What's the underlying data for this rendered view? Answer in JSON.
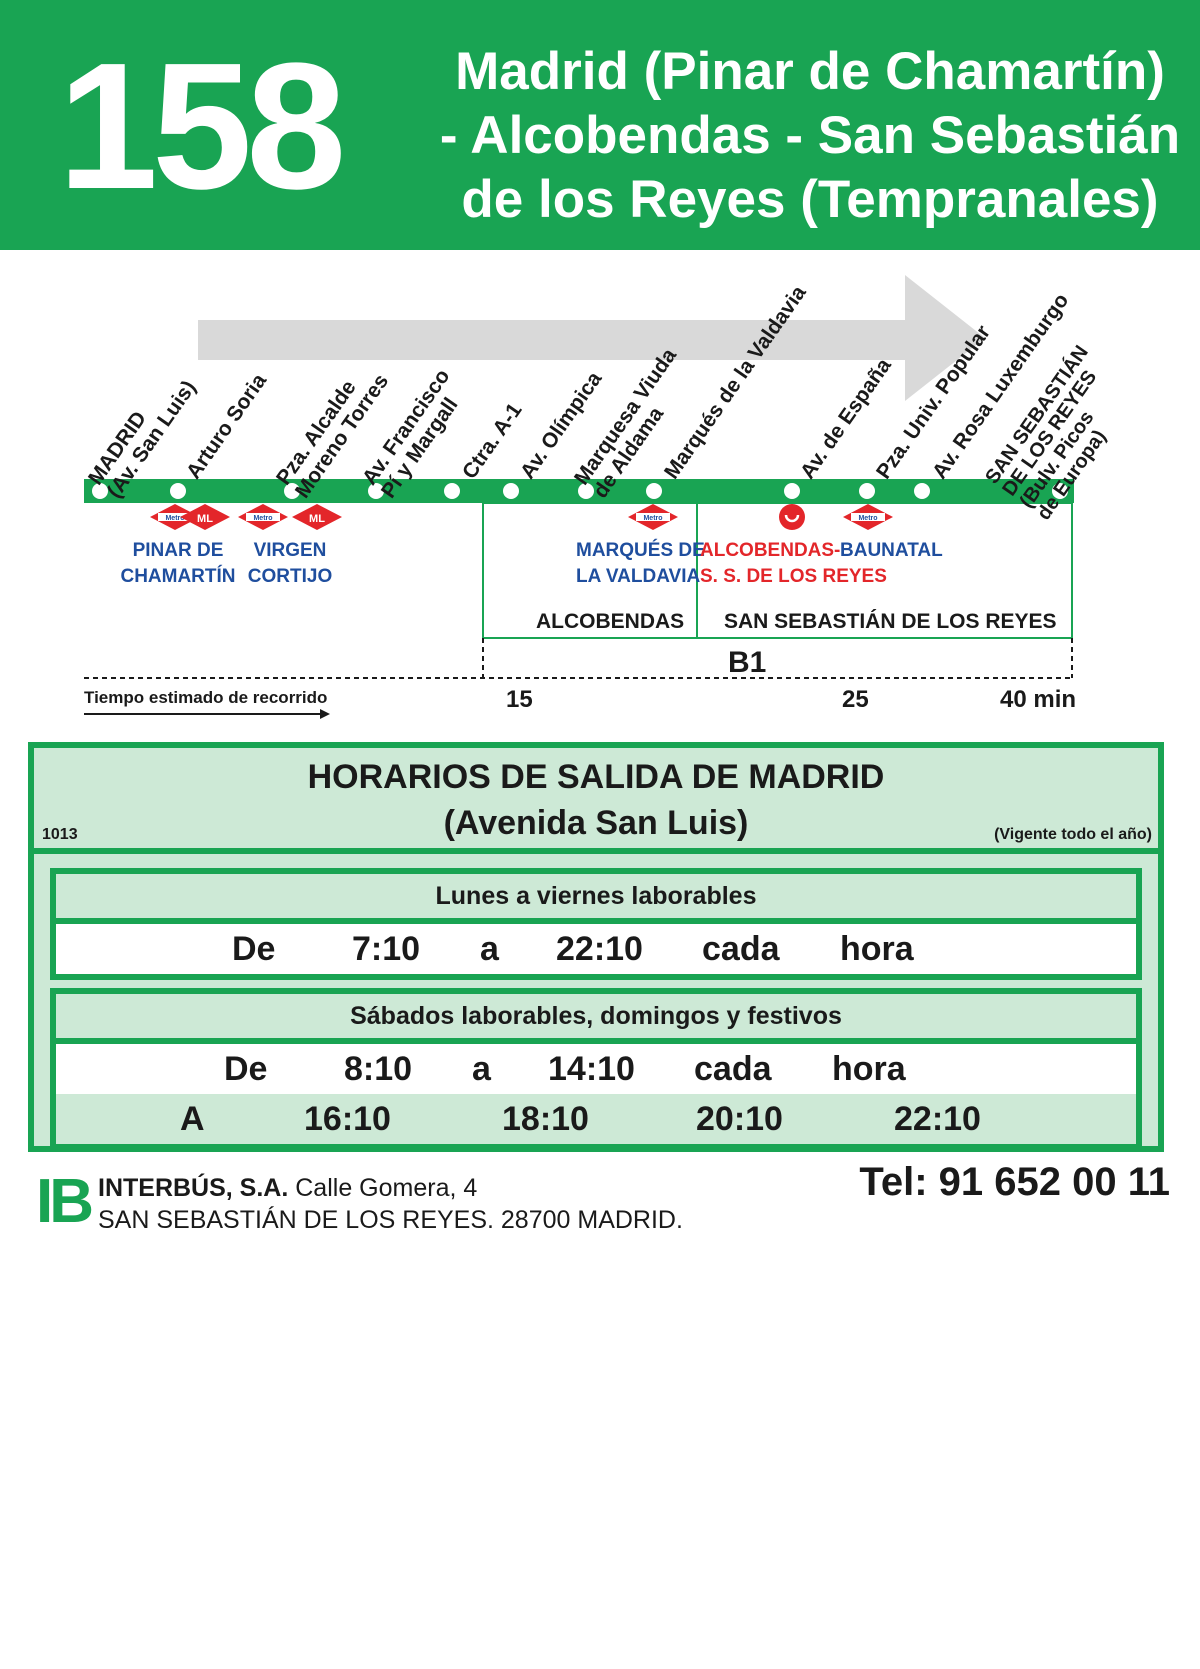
{
  "header": {
    "route_number": "158",
    "title_lines": [
      "Madrid (Pinar  de Chamartín)",
      "- Alcobendas - San Sebastián",
      "de los Reyes (Tempranales)"
    ]
  },
  "route": {
    "stops": [
      "MADRID\n(Av. San Luis)",
      "Arturo Soria",
      "Pza. Alcalde\nMoreno Torres",
      "Av. Francisco\nPí y Margall",
      "Ctra. A-1",
      "Av. Olímpica",
      "Marquesa Viuda\nde Aldama",
      "Marqués de la Valdavia",
      "Av. de España",
      "Pza. Univ. Popular",
      "Av. Rosa Luxemburgo",
      "SAN SEBASTIÁN\nDE LOS REYES\n(Bulv. Picos\nde Europa)"
    ],
    "connections": [
      {
        "text": "PINAR DE\nCHAMARTÍN",
        "color": "blue"
      },
      {
        "text": "VIRGEN\nCORTIJO",
        "color": "blue"
      },
      {
        "text": "MARQUÉS DE\nLA VALDAVIA",
        "color": "blue"
      },
      {
        "text": "ALCOBENDAS-\nS. S. DE LOS REYES",
        "color": "red"
      },
      {
        "text": "BAUNATAL",
        "color": "blue"
      }
    ],
    "badges": {
      "metro": "Metro",
      "ml": "ML"
    },
    "zones": {
      "alcobendas": "ALCOBENDAS",
      "ssreyes": "SAN SEBASTIÁN DE LOS REYES",
      "fare": "B1"
    },
    "travel_time": {
      "caption": "Tiempo estimado de recorrido",
      "marks": [
        "15",
        "25",
        "40 min"
      ]
    },
    "colors": {
      "green": "#19a453",
      "light_green": "#cde9d6",
      "metro_red": "#e3262a",
      "blue": "#1f4e9e",
      "arrow_grey": "#d9d9d9"
    }
  },
  "schedule": {
    "title_line1": "HORARIOS DE SALIDA DE MADRID",
    "title_line2": "(Avenida San Luis)",
    "code": "1013",
    "validity": "(Vigente todo el año)",
    "weekday": {
      "heading": "Lunes a viernes laborables",
      "row": [
        "De",
        "7:10",
        "a",
        "22:10",
        "cada",
        "hora"
      ]
    },
    "weekend": {
      "heading": "Sábados laborables, domingos y festivos",
      "row1": [
        "De",
        "8:10",
        "a",
        "14:10",
        "cada",
        "hora"
      ],
      "row2": [
        "A",
        "16:10",
        "18:10",
        "20:10",
        "22:10"
      ]
    }
  },
  "footer": {
    "logo": "IB",
    "company_name": "INTERBÚS, S.A.",
    "address_line1": "Calle Gomera, 4",
    "address_line2": "SAN SEBASTIÁN DE LOS REYES. 28700 MADRID.",
    "phone": "Tel: 91 652 00 11"
  }
}
